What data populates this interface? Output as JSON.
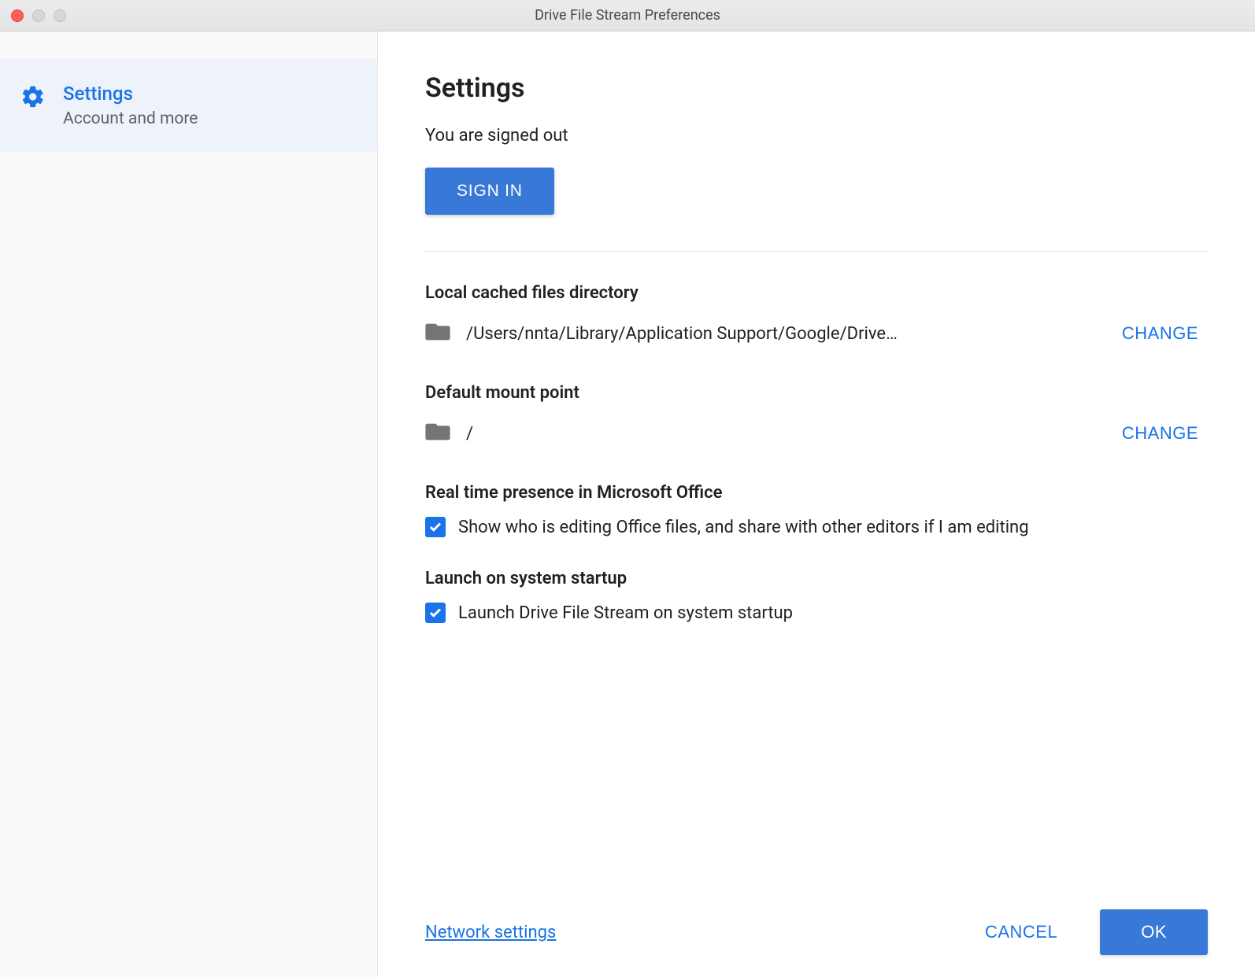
{
  "window": {
    "title": "Drive File Stream Preferences"
  },
  "sidebar": {
    "item": {
      "title": "Settings",
      "subtitle": "Account and more"
    }
  },
  "main": {
    "page_title": "Settings",
    "signed_out_text": "You are signed out",
    "sign_in_label": "SIGN IN",
    "sections": {
      "cache": {
        "title": "Local cached files directory",
        "path": "/Users/nnta/Library/Application Support/Google/Drive…",
        "change_label": "CHANGE"
      },
      "mount": {
        "title": "Default mount point",
        "path": "/",
        "change_label": "CHANGE"
      },
      "presence": {
        "title": "Real time presence in Microsoft Office",
        "checkbox_label": "Show who is editing Office files, and share with other editors if I am editing"
      },
      "startup": {
        "title": "Launch on system startup",
        "checkbox_label": "Launch Drive File Stream on system startup"
      }
    }
  },
  "footer": {
    "network_link": "Network settings",
    "cancel_label": "CANCEL",
    "ok_label": "OK"
  }
}
